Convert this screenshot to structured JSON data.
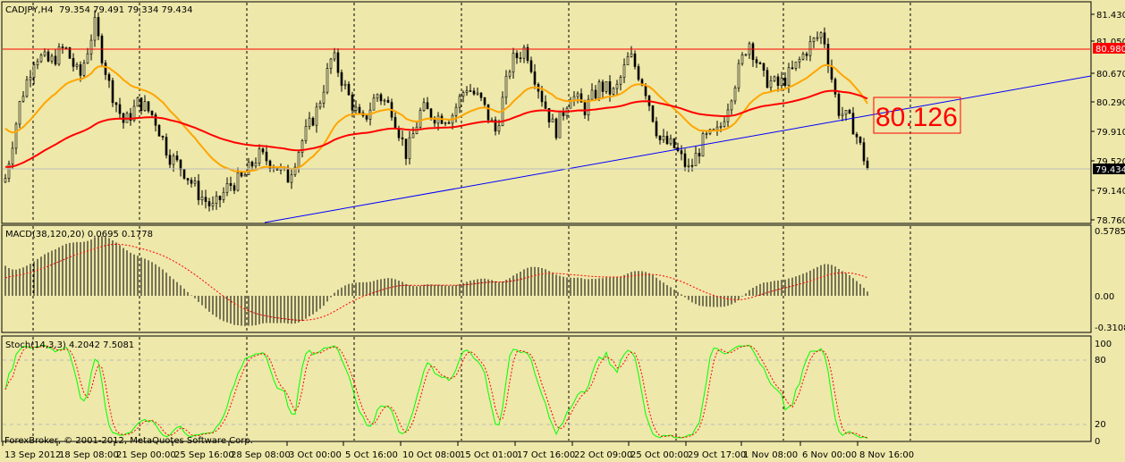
{
  "header": {
    "symbol": "CADJPY,H4",
    "ohlc": "79.354 79.491 79.334 79.434"
  },
  "macd_label": "MACD(38,120,20) 0.0695 0.1778",
  "stoch_label": "Stoch(14,3,3) 4.2042 7.5081",
  "copyright": "ForexBroker, © 2001-2012, MetaQuotes Software Corp.",
  "price_marker": "80.126",
  "colors": {
    "background": "#EEE8AA",
    "fast_ma": "#FFA500",
    "slow_ma": "#FF0000",
    "trendline": "#0000FF",
    "stoch_main": "#00FF00",
    "stoch_signal": "#FF0000",
    "marker": "#FF0000"
  },
  "chart_data": {
    "type": "candlestick",
    "price_axis": {
      "ticks": [
        "81.430",
        "81.050",
        "80.670",
        "80.290",
        "79.910",
        "79.520",
        "79.140",
        "78.760"
      ],
      "range": [
        78.76,
        81.43
      ],
      "bid_label": "79.434",
      "line_label": "80.980"
    },
    "macd_axis": {
      "ticks": [
        "0.5785",
        "0.00",
        "-0.3108"
      ],
      "range": [
        -0.3108,
        0.5785
      ]
    },
    "stoch_axis": {
      "ticks": [
        "100",
        "80",
        "20",
        "0"
      ],
      "range": [
        0,
        100
      ]
    },
    "time_labels": [
      "13 Sep 2012",
      "18 Sep 08:00",
      "21 Sep 00:00",
      "25 Sep 16:00",
      "28 Sep 08:00",
      "3 Oct 00:00",
      "5 Oct 16:00",
      "10 Oct 08:00",
      "15 Oct 01:00",
      "17 Oct 16:00",
      "22 Oct 09:00",
      "25 Oct 00:00",
      "29 Oct 17:00",
      "1 Nov 08:00",
      "6 Nov 00:00",
      "8 Nov 16:00"
    ],
    "approx_close_path": [
      79.3,
      80.3,
      80.9,
      80.8,
      81.0,
      80.6,
      81.3,
      80.5,
      80.0,
      80.3,
      80.1,
      79.6,
      79.4,
      79.1,
      78.9,
      79.2,
      79.3,
      79.6,
      79.5,
      79.3,
      79.8,
      80.2,
      80.9,
      80.4,
      80.0,
      80.4,
      80.2,
      79.6,
      80.2,
      80.1,
      80.1,
      80.5,
      80.3,
      79.9,
      80.8,
      81.0,
      80.4,
      79.9,
      80.4,
      80.2,
      80.5,
      80.4,
      80.9,
      80.5,
      79.8,
      79.7,
      79.4,
      79.8,
      79.9,
      80.5,
      81.1,
      80.6,
      80.5,
      80.7,
      81.0,
      81.2,
      80.2,
      80.0,
      79.434
    ]
  }
}
